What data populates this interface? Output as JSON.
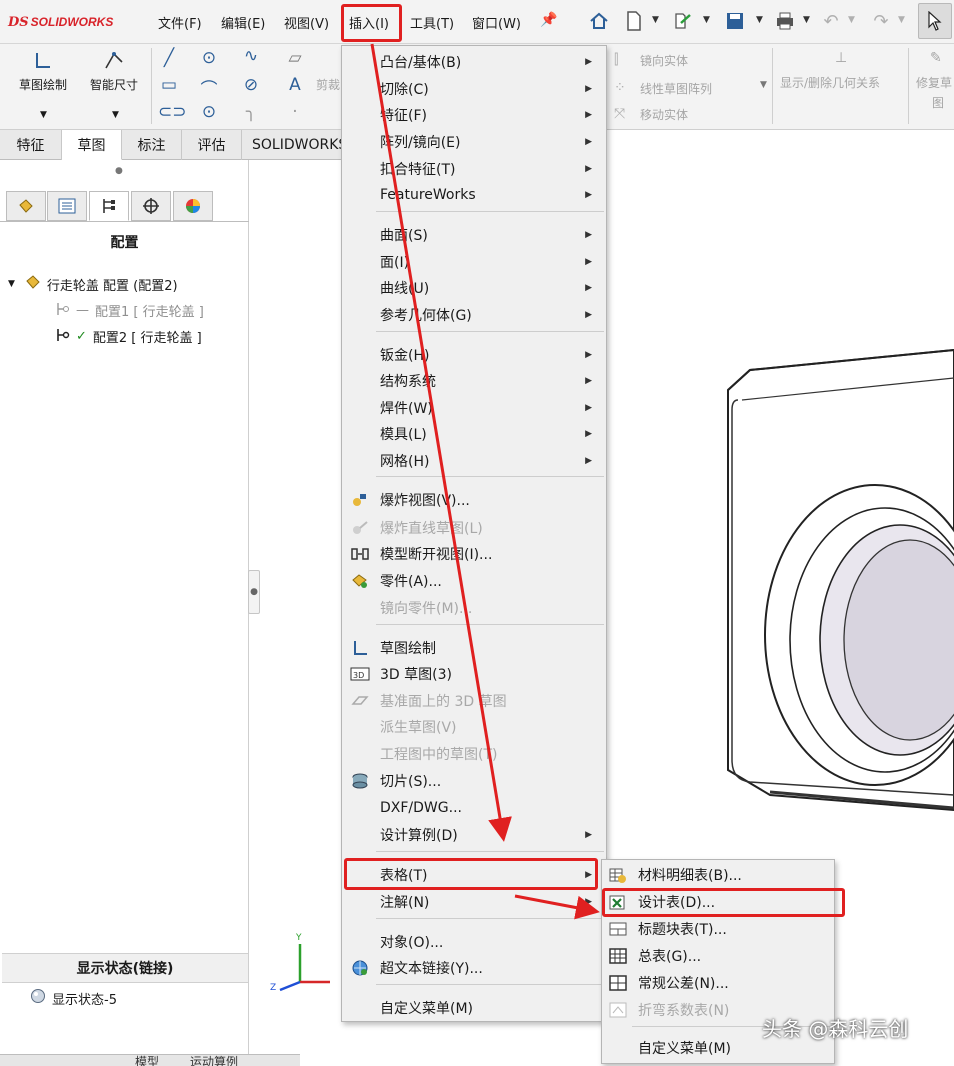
{
  "app": {
    "logo_ds": "DS",
    "logo_text": "SOLIDWORKS"
  },
  "menubar": {
    "items": [
      "文件(F)",
      "编辑(E)",
      "视图(V)",
      "插入(I)",
      "工具(T)",
      "窗口(W)"
    ]
  },
  "ribbon": {
    "sketch_label": "草图绘制",
    "smart_dim_label": "智能尺寸",
    "trim_label": "剪裁",
    "mirror_entity": "镜向实体",
    "linear_pattern": "线性草图阵列",
    "move_entity": "移动实体",
    "show_delete_relations": "显示/删除几何关系",
    "repair_sketch_1": "修复草",
    "repair_sketch_2": "图"
  },
  "tabs": [
    "特征",
    "草图",
    "标注",
    "评估",
    "SOLIDWORKS"
  ],
  "left_panel": {
    "title": "配置",
    "root": "行走轮盖 配置 (配置2)",
    "config1": "配置1 [ 行走轮盖 ]",
    "config2": "配置2 [ 行走轮盖 ]",
    "display_state_header": "显示状态(链接)",
    "display_state_item": "显示状态-5",
    "bottom_tab_1": "模型",
    "bottom_tab_2": "运动算例"
  },
  "insert_menu": {
    "items": [
      {
        "label": "凸台/基体(B)",
        "submenu": true
      },
      {
        "label": "切除(C)",
        "submenu": true
      },
      {
        "label": "特征(F)",
        "submenu": true
      },
      {
        "label": "阵列/镜向(E)",
        "submenu": true
      },
      {
        "label": "扣合特征(T)",
        "submenu": true
      },
      {
        "label": "FeatureWorks",
        "submenu": true
      },
      {
        "label": "曲面(S)",
        "submenu": true
      },
      {
        "label": "面(I)",
        "submenu": true
      },
      {
        "label": "曲线(U)",
        "submenu": true
      },
      {
        "label": "参考几何体(G)",
        "submenu": true
      },
      {
        "label": "钣金(H)",
        "submenu": true
      },
      {
        "label": "结构系统",
        "submenu": true
      },
      {
        "label": "焊件(W)",
        "submenu": true
      },
      {
        "label": "模具(L)",
        "submenu": true
      },
      {
        "label": "网格(H)",
        "submenu": true
      },
      {
        "label": "爆炸视图(V)...",
        "icon": "explode-view-icon"
      },
      {
        "label": "爆炸直线草图(L)",
        "disabled": true,
        "icon": "explode-line-icon"
      },
      {
        "label": "模型断开视图(I)...",
        "icon": "model-break-icon"
      },
      {
        "label": "零件(A)...",
        "icon": "part-icon"
      },
      {
        "label": "镜向零件(M)...",
        "disabled": true
      },
      {
        "label": "草图绘制",
        "icon": "sketch-icon"
      },
      {
        "label": "3D 草图(3)",
        "icon": "3d-sketch-icon"
      },
      {
        "label": "基准面上的 3D 草图",
        "disabled": true,
        "icon": "plane-sketch-icon"
      },
      {
        "label": "派生草图(V)",
        "disabled": true
      },
      {
        "label": "工程图中的草图(T)",
        "disabled": true
      },
      {
        "label": "切片(S)...",
        "icon": "slice-icon"
      },
      {
        "label": "DXF/DWG..."
      },
      {
        "label": "设计算例(D)",
        "submenu": true
      },
      {
        "label": "表格(T)",
        "submenu": true
      },
      {
        "label": "注解(N)",
        "submenu": true
      },
      {
        "label": "对象(O)..."
      },
      {
        "label": "超文本链接(Y)...",
        "icon": "hyperlink-icon"
      },
      {
        "label": "自定义菜单(M)"
      }
    ]
  },
  "table_submenu": {
    "items": [
      {
        "label": "材料明细表(B)...",
        "icon": "bom-icon"
      },
      {
        "label": "设计表(D)...",
        "icon": "design-table-icon"
      },
      {
        "label": "标题块表(T)...",
        "icon": "title-block-icon"
      },
      {
        "label": "总表(G)...",
        "icon": "general-table-icon"
      },
      {
        "label": "常规公差(N)...",
        "icon": "tolerance-icon"
      },
      {
        "label": "折弯系数表(N)",
        "disabled": true,
        "icon": "bend-table-icon"
      },
      {
        "label": "自定义菜单(M)"
      }
    ]
  },
  "triad": {
    "y": "Y",
    "z": "Z"
  },
  "watermark": "头条 @森科云创",
  "colors": {
    "highlight": "#e02020",
    "brand": "#d8232a",
    "icon_blue": "#2d5f98"
  }
}
